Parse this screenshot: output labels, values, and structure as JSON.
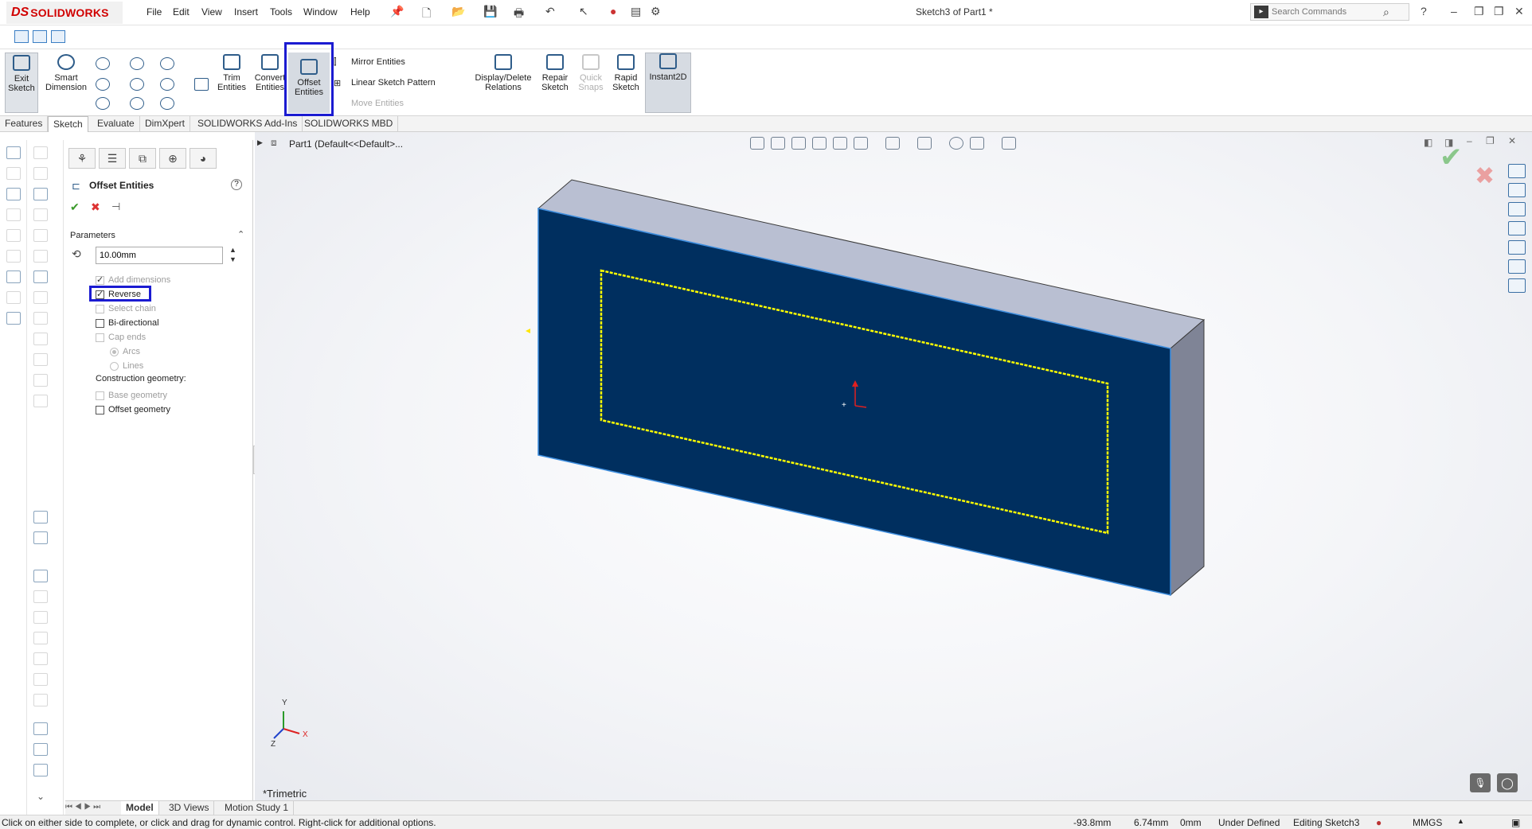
{
  "app": {
    "logo_prefix": "DS",
    "logo_text": "SOLIDWORKS",
    "document_title": "Sketch3 of Part1 *"
  },
  "menu": [
    "File",
    "Edit",
    "View",
    "Insert",
    "Tools",
    "Window",
    "Help"
  ],
  "search": {
    "placeholder": "Search Commands"
  },
  "window_controls": {
    "help": "?",
    "minimize": "–",
    "restore": "❐",
    "close": "✕"
  },
  "command_manager": {
    "exit_sketch": "Exit\nSketch",
    "smart_dimension": "Smart\nDimension",
    "trim_entities": "Trim\nEntities",
    "convert_entities": "Convert\nEntities",
    "offset_entities": "Offset\nEntities",
    "mirror_entities": "Mirror Entities",
    "linear_sketch_pattern": "Linear Sketch Pattern",
    "move_entities": "Move Entities",
    "display_delete_relations": "Display/Delete\nRelations",
    "repair_sketch": "Repair\nSketch",
    "quick_snaps": "Quick\nSnaps",
    "rapid_sketch": "Rapid\nSketch",
    "instant2d": "Instant2D"
  },
  "tabs": [
    "Features",
    "Sketch",
    "Evaluate",
    "DimXpert",
    "SOLIDWORKS Add-Ins",
    "SOLIDWORKS MBD"
  ],
  "active_tab": "Sketch",
  "property_manager": {
    "title": "Offset Entities",
    "help": "?",
    "section": "Parameters",
    "distance": "10.00mm",
    "add_dimensions": "Add dimensions",
    "reverse": "Reverse",
    "select_chain": "Select chain",
    "bi_directional": "Bi-directional",
    "cap_ends": "Cap ends",
    "arcs": "Arcs",
    "lines": "Lines",
    "construction_geometry": "Construction geometry:",
    "base_geometry": "Base geometry",
    "offset_geometry": "Offset geometry"
  },
  "tree": {
    "part": "Part1  (Default<<Default>..."
  },
  "viewport": {
    "view_name": "*Trimetric",
    "face_color": "#002f5f",
    "top_color": "#b9bfd2",
    "side_color": "#7f8496",
    "sketch_color": "#ffff00",
    "axis_y": "Y",
    "axis_x": "X",
    "axis_z": "Z"
  },
  "bottom_tabs": [
    "Model",
    "3D Views",
    "Motion Study 1"
  ],
  "status": {
    "message": "Click on either side to complete, or click and drag for dynamic control.  Right-click for additional options.",
    "x": "-93.8mm",
    "y": "6.74mm",
    "z": "0mm",
    "definition": "Under Defined",
    "editing": "Editing Sketch3",
    "units": "MMGS"
  },
  "colors": {
    "highlight": "#1b1bd1",
    "accent": "#d10000",
    "confirm": "#3a9a2a",
    "cancel": "#d33"
  }
}
